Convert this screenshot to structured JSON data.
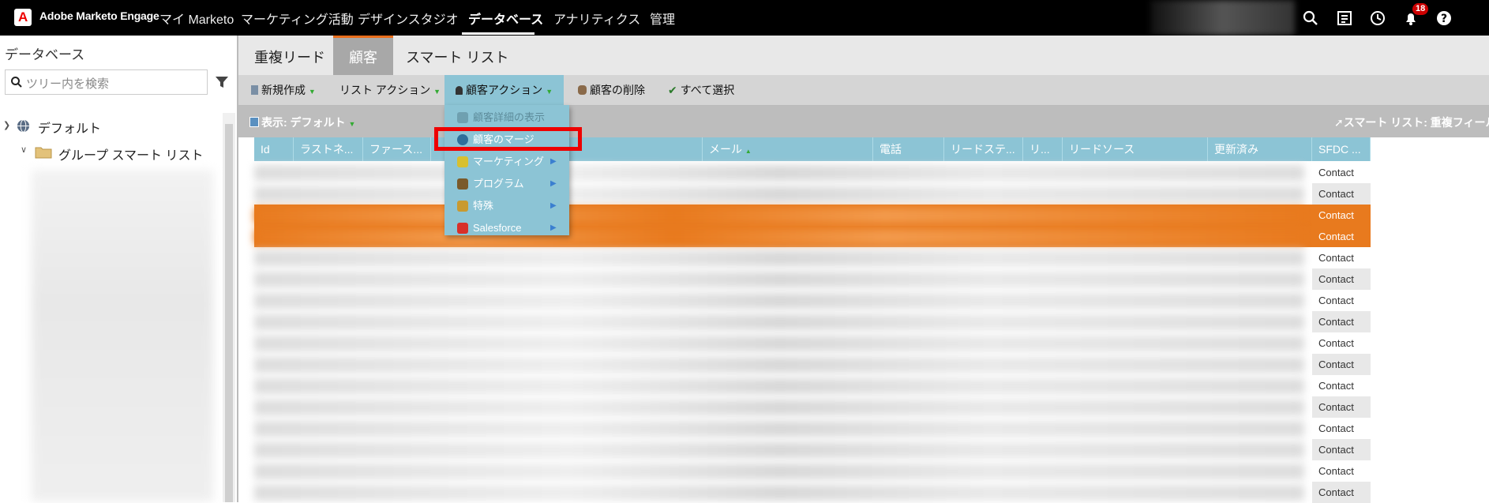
{
  "topnav": {
    "brand": "Adobe Marketo Engage",
    "items": [
      "マイ Marketo",
      "マーケティング活動",
      "デザインスタジオ",
      "データベース",
      "アナリティクス",
      "管理"
    ],
    "active": "データベース",
    "notification_count": "18",
    "icons": [
      "search-icon",
      "checklist-icon",
      "clock-icon",
      "bell-icon",
      "help-icon"
    ]
  },
  "sidebar": {
    "title": "データベース",
    "search_placeholder": "ツリー内を検索",
    "tree": [
      {
        "label": "デフォルト",
        "icon": "globe-icon"
      },
      {
        "label": "グループ スマート リスト",
        "icon": "folder-icon"
      }
    ]
  },
  "tabs": [
    "重複リード",
    "顧客",
    "スマート リスト"
  ],
  "active_tab": "顧客",
  "toolbar": {
    "new": "新規作成",
    "list_action": "リスト アクション",
    "person_action": "顧客アクション",
    "delete_person": "顧客の削除",
    "select_all": "すべて選択"
  },
  "viewbar": {
    "view_label": "表示: デフォルト",
    "smartlist_label": "スマート リスト: 重複フィール"
  },
  "grid": {
    "columns": [
      "Id",
      "ラストネ...",
      "ファース...",
      "",
      "",
      "メール",
      "電話",
      "リードステ...",
      "リ...",
      "リードソース",
      "更新済み",
      "SFDC ..."
    ],
    "rows": [
      {
        "sfdc": "Contact"
      },
      {
        "sfdc": "Contact"
      },
      {
        "sfdc": "Contact"
      },
      {
        "sfdc": "Contact"
      },
      {
        "sfdc": "Contact"
      },
      {
        "sfdc": "Contact"
      },
      {
        "sfdc": "Contact"
      },
      {
        "sfdc": "Contact"
      },
      {
        "sfdc": "Contact"
      },
      {
        "sfdc": "Contact"
      },
      {
        "sfdc": "Contact"
      },
      {
        "sfdc": "Contact"
      },
      {
        "sfdc": "Contact"
      },
      {
        "sfdc": "Contact"
      },
      {
        "sfdc": "Contact"
      },
      {
        "sfdc": "Contact"
      }
    ],
    "selected_rows": [
      2,
      3
    ]
  },
  "person_action_menu": [
    {
      "label": "顧客詳細の表示",
      "disabled": true,
      "submenu": false,
      "icon": "person-detail-icon"
    },
    {
      "label": "顧客のマージ",
      "disabled": false,
      "submenu": false,
      "icon": "merge-icon",
      "highlighted": true
    },
    {
      "label": "マーケティング",
      "disabled": false,
      "submenu": true,
      "icon": "marketing-icon"
    },
    {
      "label": "プログラム",
      "disabled": false,
      "submenu": true,
      "icon": "program-icon"
    },
    {
      "label": "特殊",
      "disabled": false,
      "submenu": true,
      "icon": "special-icon"
    },
    {
      "label": "Salesforce",
      "disabled": false,
      "submenu": true,
      "icon": "salesforce-icon"
    }
  ],
  "colors": {
    "accent_orange": "#e87a1e",
    "menu_blue": "#8cc4d5",
    "highlight_red": "#e00000"
  }
}
